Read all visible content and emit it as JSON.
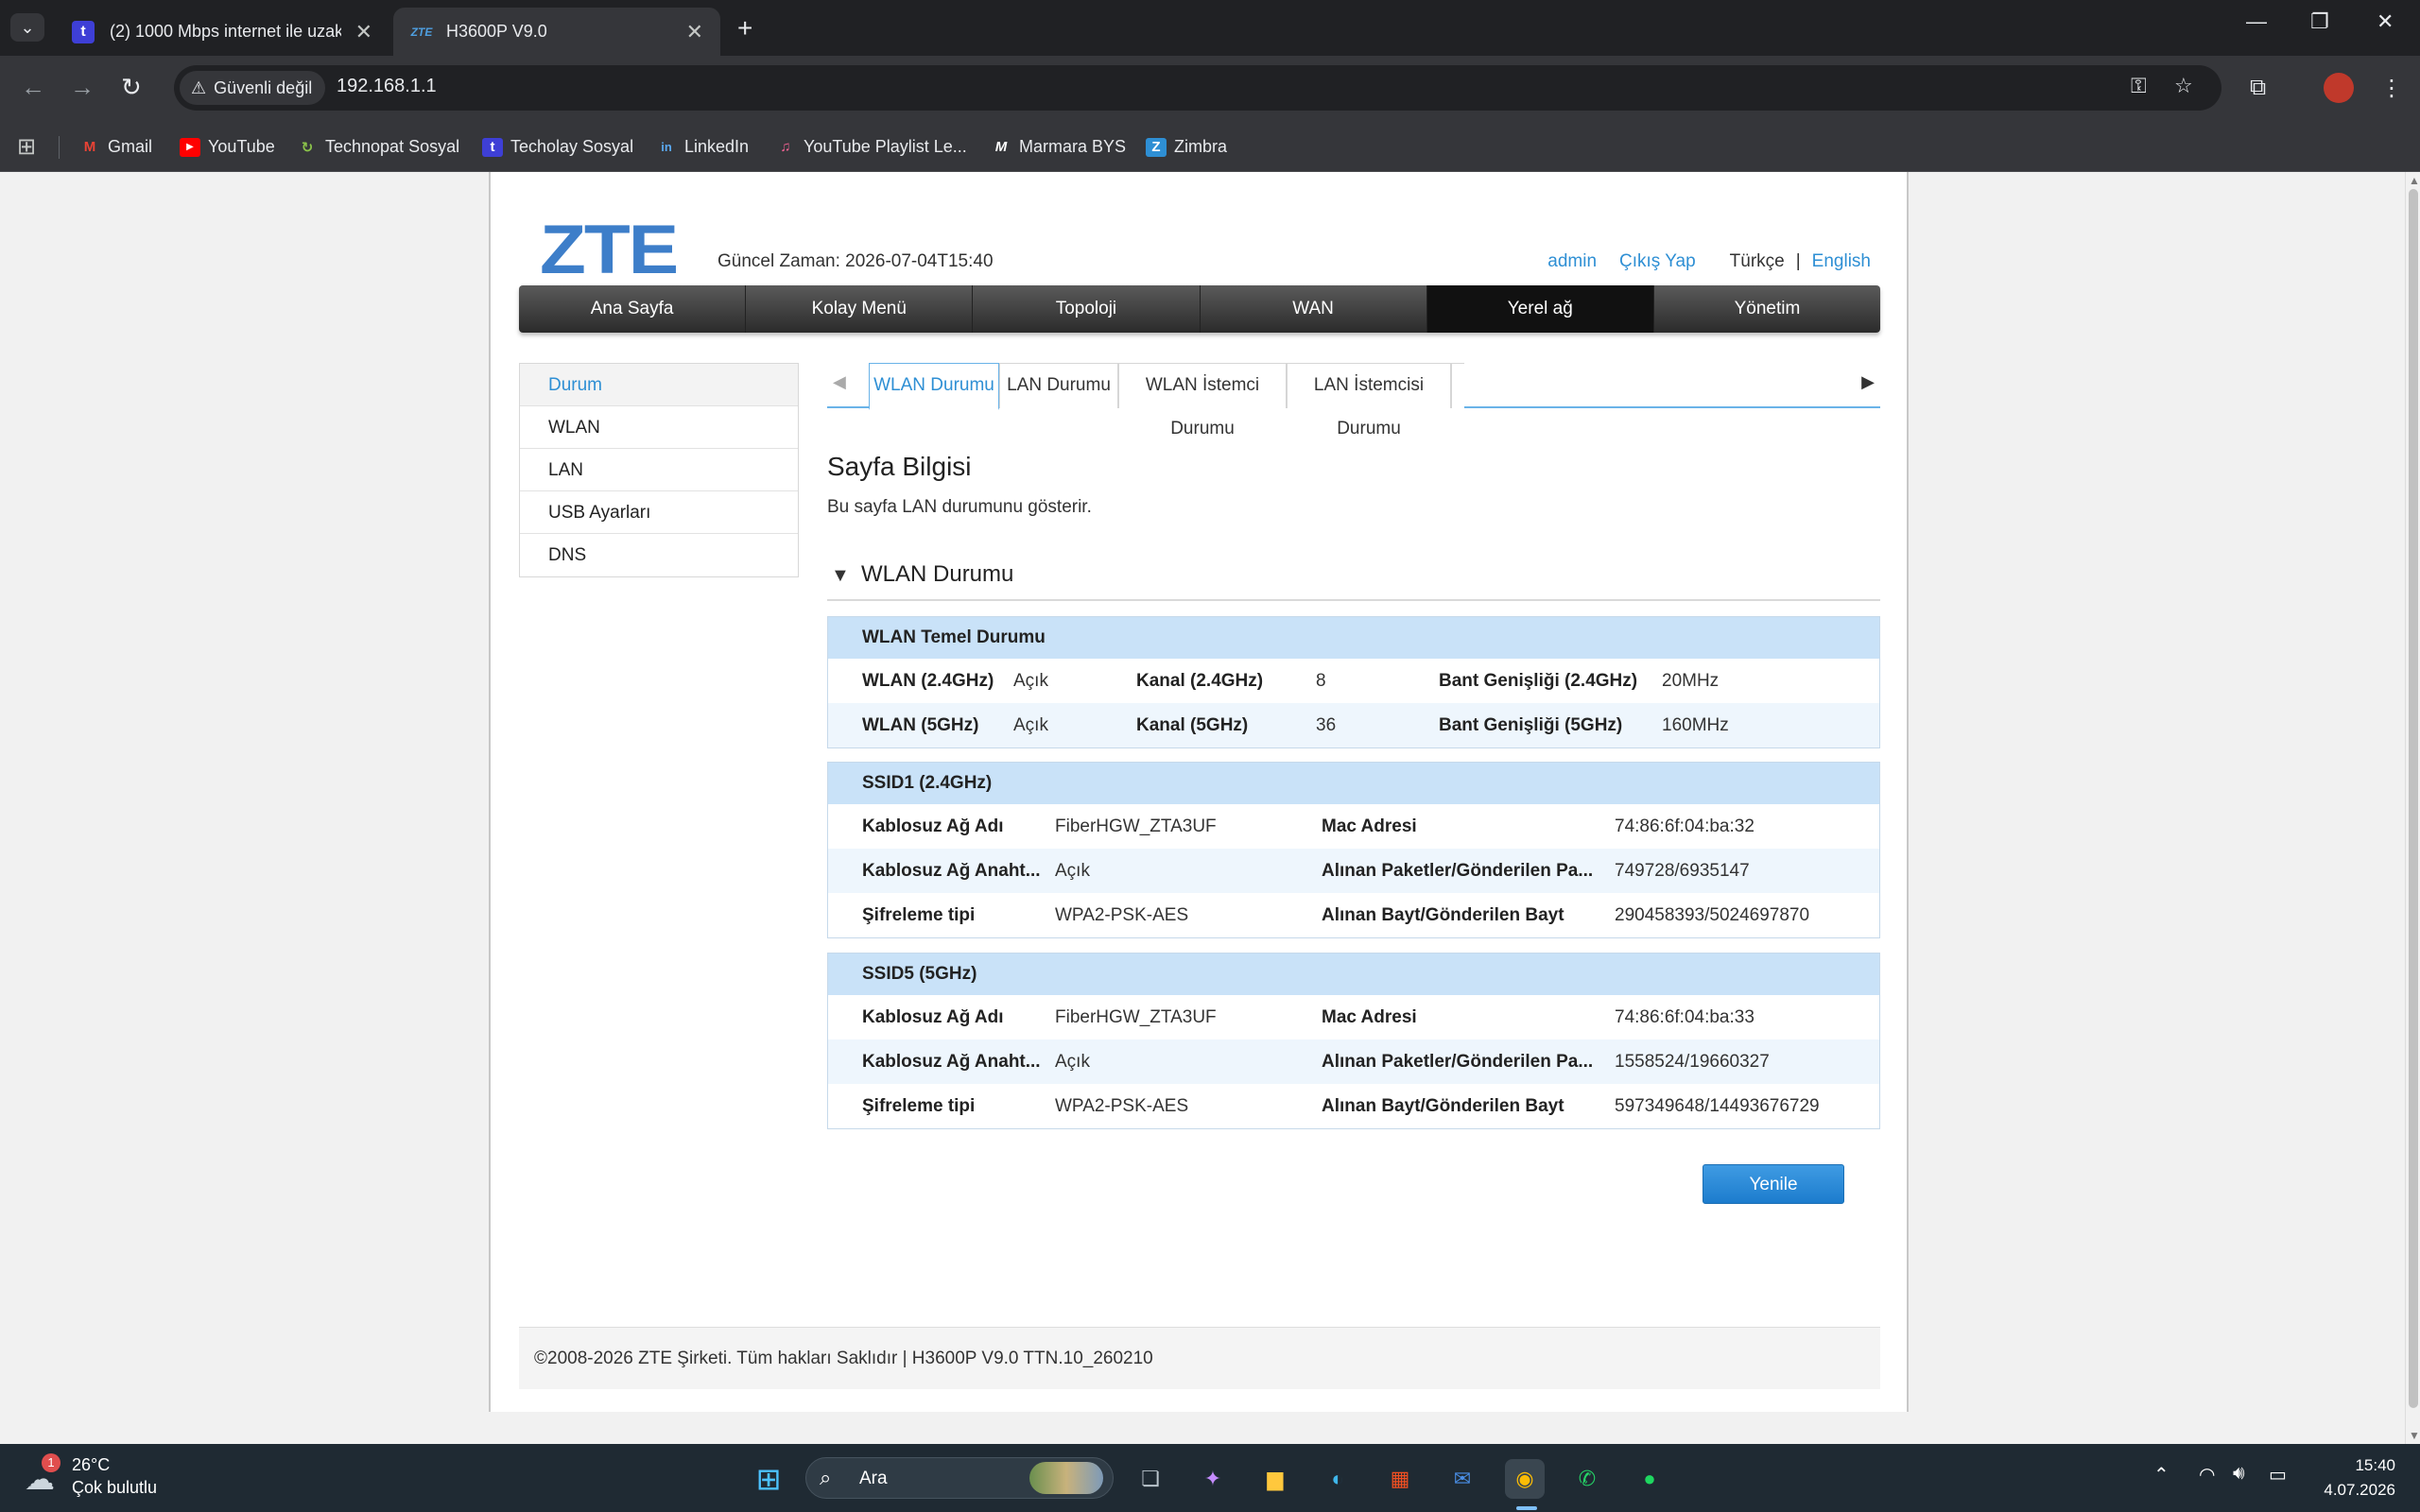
{
  "browser": {
    "tabs": [
      {
        "title": "(2) 1000 Mbps internet ile uzak",
        "favicon": "t"
      },
      {
        "title": "H3600P V9.0",
        "favicon": "ZTE"
      }
    ],
    "security_label": "Güvenli değil",
    "url": "192.168.1.1",
    "bookmarks": [
      {
        "label": "Gmail",
        "icon": "M"
      },
      {
        "label": "YouTube",
        "icon": "▶"
      },
      {
        "label": "Technopat Sosyal",
        "icon": "↻"
      },
      {
        "label": "Techolay Sosyal",
        "icon": "t"
      },
      {
        "label": "LinkedIn",
        "icon": "in"
      },
      {
        "label": "YouTube Playlist Le...",
        "icon": "♫"
      },
      {
        "label": "Marmara BYS",
        "icon": "M"
      },
      {
        "label": "Zimbra",
        "icon": "Z"
      }
    ]
  },
  "router": {
    "logo": "ZTE",
    "current_time": "Güncel Zaman: 2026-07-04T15:40",
    "user": "admin",
    "logout": "Çıkış Yap",
    "lang_current": "Türkçe",
    "lang_sep": "|",
    "lang_other": "English",
    "main_nav": [
      "Ana Sayfa",
      "Kolay Menü",
      "Topoloji",
      "WAN",
      "Yerel ağ",
      "Yönetim"
    ],
    "sidebar": [
      "Durum",
      "WLAN",
      "LAN",
      "USB Ayarları",
      "DNS"
    ],
    "sub_tabs": [
      "WLAN Durumu",
      "LAN Durumu",
      "WLAN İstemci Durumu",
      "LAN İstemcisi Durumu"
    ],
    "page_title": "Sayfa Bilgisi",
    "page_desc": "Bu sayfa LAN durumunu gösterir.",
    "section_title": "WLAN Durumu",
    "basic": {
      "header": "WLAN Temel Durumu",
      "rows": [
        [
          "WLAN (2.4GHz)",
          "Açık",
          "Kanal (2.4GHz)",
          "8",
          "Bant Genişliği (2.4GHz)",
          "20MHz"
        ],
        [
          "WLAN (5GHz)",
          "Açık",
          "Kanal (5GHz)",
          "36",
          "Bant Genişliği (5GHz)",
          "160MHz"
        ]
      ]
    },
    "ssid1": {
      "header": "SSID1 (2.4GHz)",
      "rows": [
        [
          "Kablosuz Ağ Adı",
          "FiberHGW_ZTA3UF",
          "Mac Adresi",
          "74:86:6f:04:ba:32"
        ],
        [
          "Kablosuz Ağ Anaht...",
          "Açık",
          "Alınan Paketler/Gönderilen Pa...",
          "749728/6935147"
        ],
        [
          "Şifreleme tipi",
          "WPA2-PSK-AES",
          "Alınan Bayt/Gönderilen Bayt",
          "290458393/5024697870"
        ]
      ]
    },
    "ssid5": {
      "header": "SSID5 (5GHz)",
      "rows": [
        [
          "Kablosuz Ağ Adı",
          "FiberHGW_ZTA3UF",
          "Mac Adresi",
          "74:86:6f:04:ba:33"
        ],
        [
          "Kablosuz Ağ Anaht...",
          "Açık",
          "Alınan Paketler/Gönderilen Pa...",
          "1558524/19660327"
        ],
        [
          "Şifreleme tipi",
          "WPA2-PSK-AES",
          "Alınan Bayt/Gönderilen Bayt",
          "597349648/14493676729"
        ]
      ]
    },
    "refresh": "Yenile",
    "footer": "©2008-2026 ZTE Şirketi. Tüm hakları Saklıdır  |   H3600P V9.0 TTN.10_260210"
  },
  "taskbar": {
    "weather_badge": "1",
    "temp": "26°C",
    "condition": "Çok bulutlu",
    "search_placeholder": "Ara",
    "time": "15:40",
    "date": "4.07.2026"
  }
}
